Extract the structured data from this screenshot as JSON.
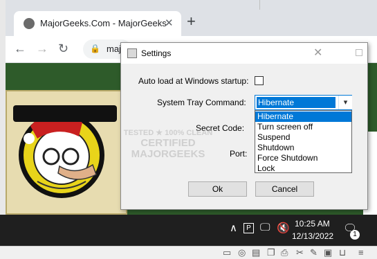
{
  "browser": {
    "tab_title": "MajorGeeks.Com - MajorGeeks",
    "tab_close": "✕",
    "new_tab": "+",
    "back": "←",
    "forward": "→",
    "reload": "↻",
    "address_partial": "maj",
    "lock": "🔒"
  },
  "dialog": {
    "title": "Settings",
    "close_glyph": "✕",
    "autoload_label": "Auto load at Windows startup:",
    "autoload_checked": false,
    "tray_label": "System Tray Command:",
    "tray_selected": "Hibernate",
    "tray_options": [
      "Hibernate",
      "Turn screen off",
      "Suspend",
      "Shutdown",
      "Force Shutdown",
      "Lock"
    ],
    "secret_label": "Secret Code:",
    "port_label": "Port:",
    "ok_label": "Ok",
    "cancel_label": "Cancel"
  },
  "watermark": {
    "line1": "TESTED ★ 100% CLEAN",
    "line2": "CERTIFIED",
    "line3": "MAJORGEEKS"
  },
  "taskbar": {
    "time": "10:25 AM",
    "date": "12/13/2022",
    "notification_count": "1",
    "tray_icons": [
      "chevron-up-icon",
      "app-tray-icon",
      "network-icon",
      "volume-muted-icon"
    ]
  },
  "colors": {
    "accent": "#0078d7",
    "page_bg": "#2e5b2a",
    "taskbar": "#1f1f1f"
  }
}
